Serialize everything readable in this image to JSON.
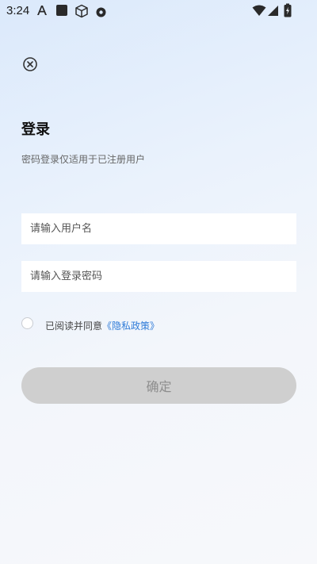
{
  "status_bar": {
    "time": "3:24",
    "icons": [
      "font-a-icon",
      "square-app-icon",
      "box-icon",
      "notification-icon",
      "wifi-icon",
      "signal-icon",
      "battery-icon"
    ]
  },
  "header": {
    "close_icon": "close-circle-icon"
  },
  "login": {
    "title": "登录",
    "subtitle": "密码登录仅适用于已注册用户",
    "username_placeholder": "请输入用户名",
    "password_placeholder": "请输入登录密码",
    "agree_text": "已阅读并同意",
    "policy_link": "《隐私政策》",
    "confirm_label": "确定"
  },
  "colors": {
    "accent_link": "#2f7bd8",
    "button_disabled_bg": "#cfcfcf",
    "button_disabled_text": "#8d8d8d",
    "background_top": "#dbe9fb",
    "background_bottom": "#f7f8fb"
  }
}
